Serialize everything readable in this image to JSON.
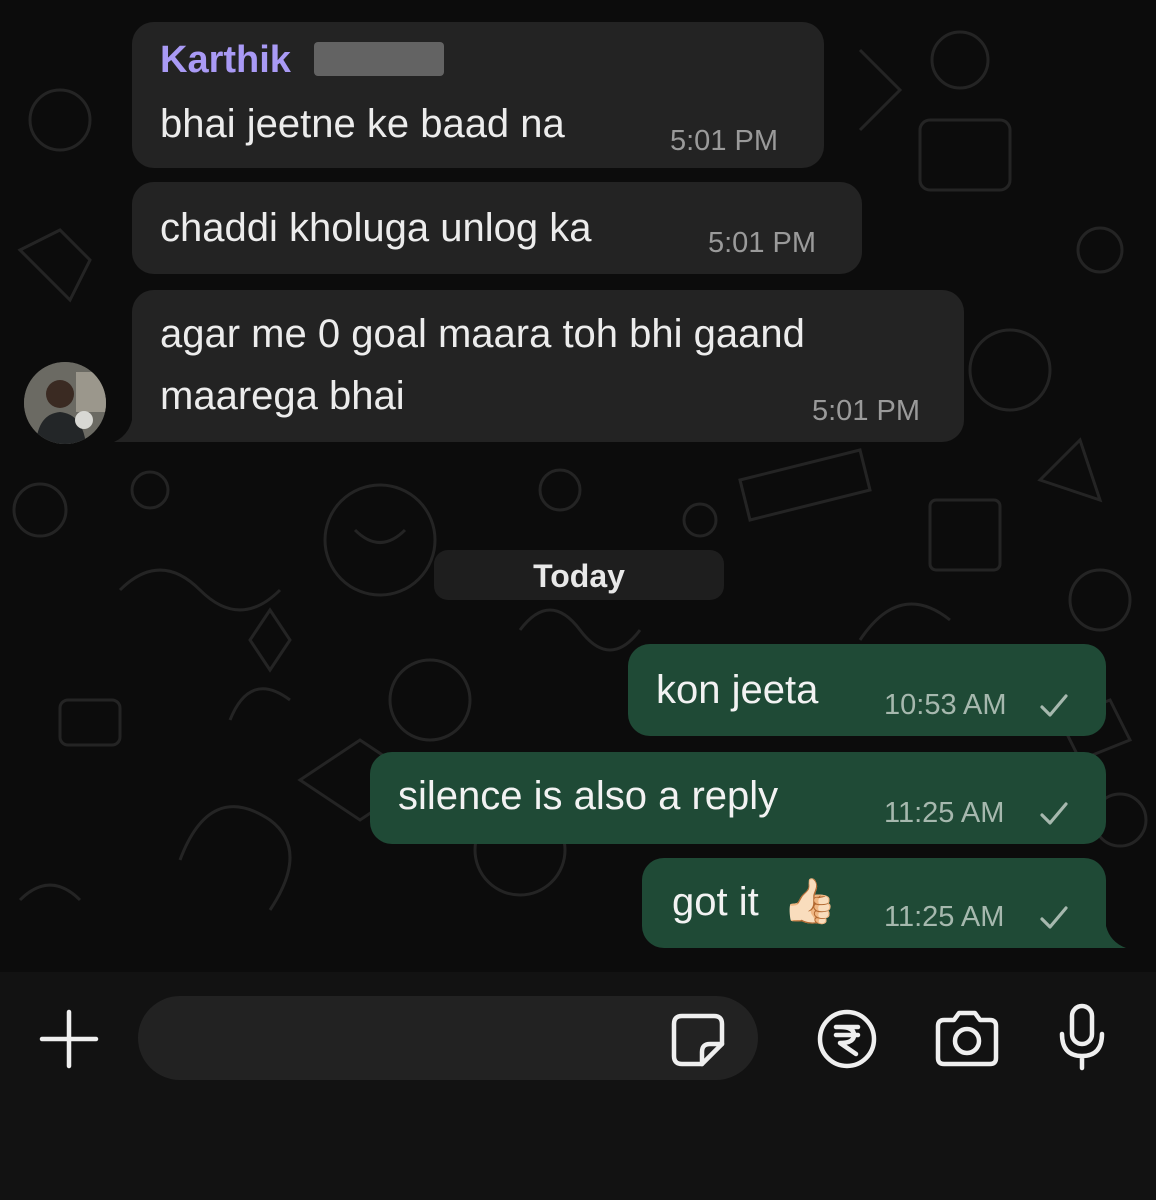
{
  "chat": {
    "incoming": [
      {
        "sender": "Karthik",
        "text": "bhai jeetne ke baad na",
        "time": "5:01 PM"
      },
      {
        "text": "chaddi kholuga unlog ka",
        "time": "5:01 PM"
      },
      {
        "line1": "agar me 0 goal maara toh bhi gaand",
        "line2": "maarega bhai",
        "time": "5:01 PM"
      }
    ],
    "date_separator": "Today",
    "outgoing": [
      {
        "text": "kon jeeta",
        "time": "10:53 AM",
        "status": "sent-check"
      },
      {
        "text": "silence is also a reply",
        "time": "11:25 AM",
        "status": "sent-check"
      },
      {
        "text": "got it",
        "emoji": "👍🏻",
        "time": "11:25 AM",
        "status": "sent-check"
      }
    ]
  },
  "composer": {
    "placeholder": "",
    "icons": [
      "plus-icon",
      "sticker-icon",
      "rupee-payment-icon",
      "camera-icon",
      "microphone-icon"
    ]
  },
  "colors": {
    "incoming_bubble": "#232323",
    "outgoing_bubble": "#1f4a36",
    "sender_name": "#a99af5",
    "background": "#0c0c0c"
  }
}
